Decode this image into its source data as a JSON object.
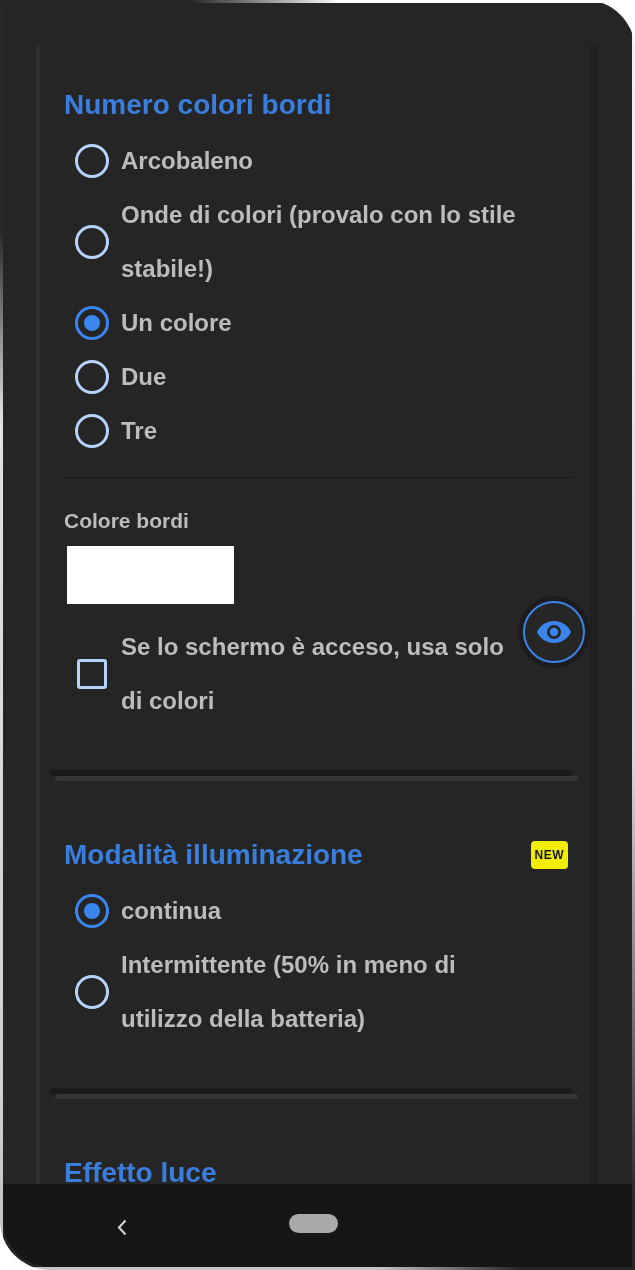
{
  "sections": [
    {
      "title": "Numero colori bordi",
      "options": [
        {
          "label": "Arcobaleno",
          "selected": false
        },
        {
          "label": "Onde di colori (provalo con lo stile stabile!)",
          "selected": false
        },
        {
          "label": "Un colore",
          "selected": true
        },
        {
          "label": "Due",
          "selected": false
        },
        {
          "label": "Tre",
          "selected": false
        }
      ],
      "color_setting": {
        "label": "Colore bordi",
        "color": "#ffffff"
      },
      "checkbox": {
        "label_lines": [
          "Se lo schermo è acceso, usa solo",
          "di colori"
        ],
        "checked": false
      }
    },
    {
      "title": "Modalità illuminazione",
      "badge": "NEW",
      "options": [
        {
          "label": "continua",
          "selected": true
        },
        {
          "label": "Intermittente (50% in meno di utilizzo della batteria)",
          "selected": false
        }
      ]
    },
    {
      "title": "Effetto luce"
    }
  ]
}
